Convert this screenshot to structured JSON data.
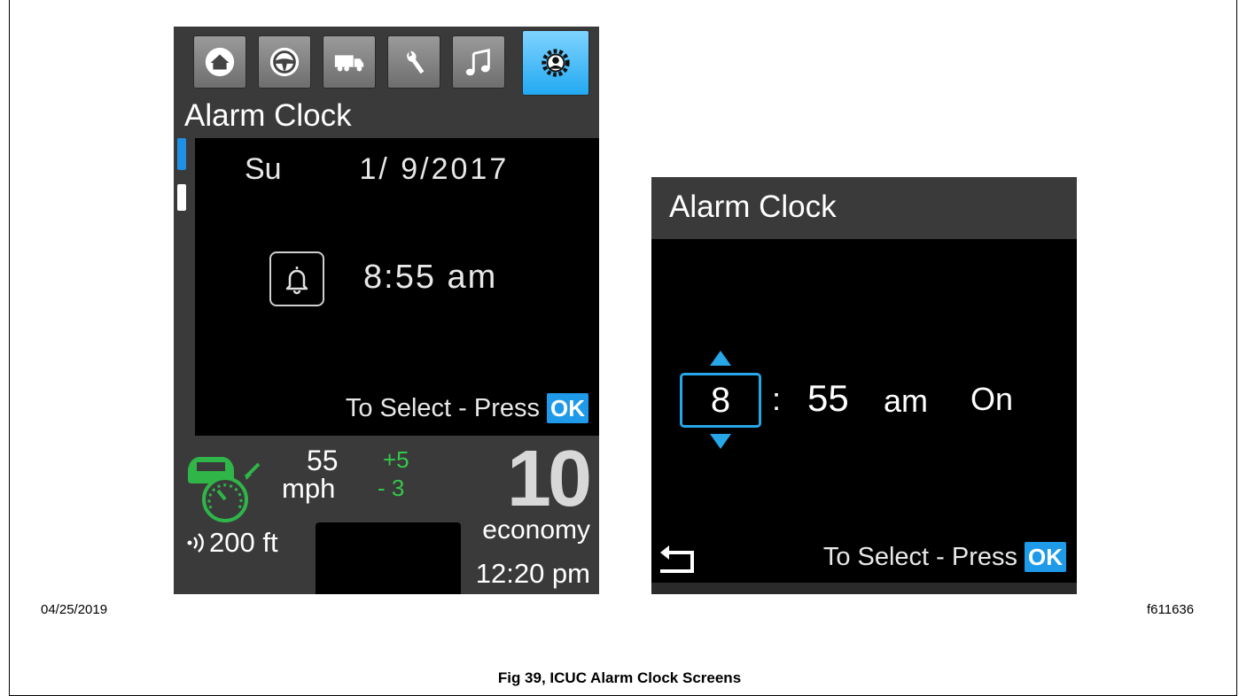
{
  "left_screen": {
    "tabs": [
      {
        "icon": "home-icon",
        "active": false
      },
      {
        "icon": "steering-wheel-icon",
        "active": false
      },
      {
        "icon": "truck-icon",
        "active": false
      },
      {
        "icon": "wrench-icon",
        "active": false
      },
      {
        "icon": "music-icon",
        "active": false
      },
      {
        "icon": "settings-icon",
        "active": true
      }
    ],
    "title": "Alarm Clock",
    "day": "Su",
    "date": "1/ 9/2017",
    "alarm_time": "8:55 am",
    "select_text": "To Select - Press",
    "ok_label": "OK",
    "speed": "55",
    "speed_unit": "mph",
    "plus_offset": "+5",
    "minus_offset": "- 3",
    "big_number": "10",
    "follow_distance": "200 ft",
    "mode": "economy",
    "clock": "12:20 pm"
  },
  "right_screen": {
    "title": "Alarm Clock",
    "hour": "8",
    "colon": ":",
    "minutes": "55",
    "ampm": "am",
    "state": "On",
    "select_text": "To Select - Press",
    "ok_label": "OK"
  },
  "date_stamp": "04/25/2019",
  "figure_id": "f611636",
  "caption": "Fig 39, ICUC Alarm Clock Screens",
  "colors": {
    "accent_blue": "#1e9ae8",
    "active_tab": "#22a9f2",
    "green": "#34c84a",
    "screen_gray": "#3a3a3a"
  }
}
